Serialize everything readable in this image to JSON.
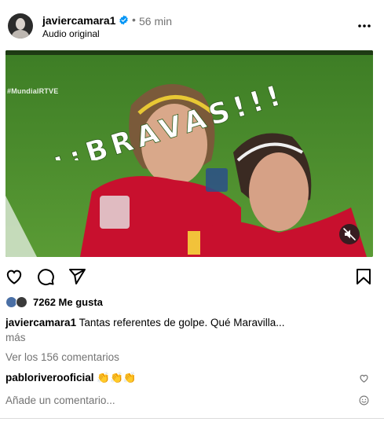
{
  "post": {
    "username": "javiercamara1",
    "separator": "•",
    "time": "56 min",
    "audio": "Audio original",
    "media": {
      "watermark": "#MundialRTVE",
      "overlay_text": "¡¡¡¡BRAVAS!!!"
    },
    "likes": "7262 Me gusta",
    "caption": {
      "username": "javiercamara1",
      "text": "Tantas referentes de golpe. Qué Maravilla...",
      "more": "más"
    },
    "view_comments": "Ver los 156 comentarios",
    "comment": {
      "username": "pablorivero​oficial",
      "text": "👏👏👏"
    },
    "add_comment_placeholder": "Añade un comentario..."
  },
  "colors": {
    "verified": "#0095f6",
    "muted_text": "#737373",
    "pitch_green": "#4d8e2c",
    "shirt_red": "#c8102e"
  },
  "icons": {
    "more": "more-options-icon",
    "like": "heart-icon",
    "comment": "comment-icon",
    "share": "paper-plane-icon",
    "save": "bookmark-icon",
    "mute": "speaker-muted-icon",
    "emoji": "emoji-icon"
  }
}
